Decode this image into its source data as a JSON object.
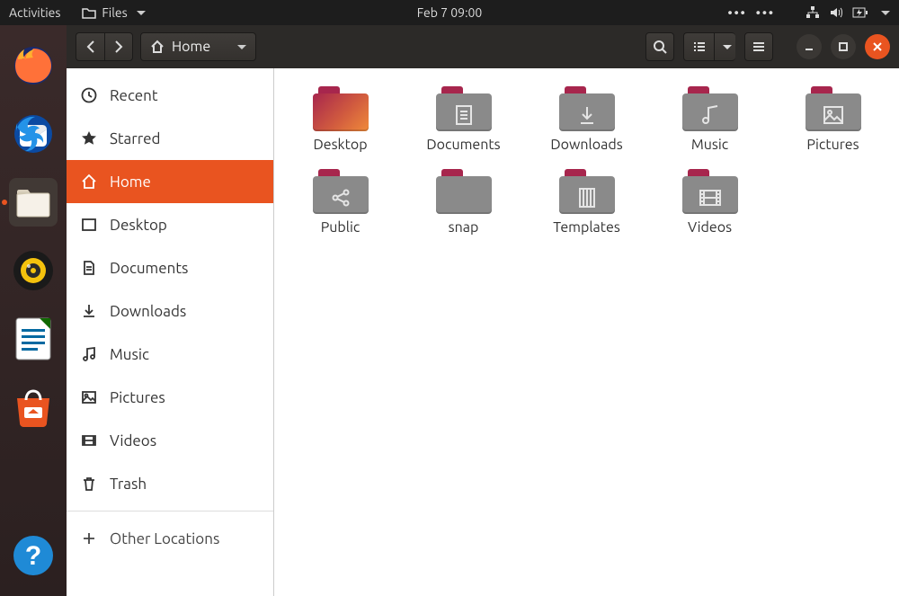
{
  "top_panel": {
    "activities": "Activities",
    "app_menu": "Files",
    "datetime": "Feb 7  09:00"
  },
  "titlebar": {
    "location": "Home"
  },
  "sidebar": {
    "items": [
      {
        "id": "recent",
        "label": "Recent"
      },
      {
        "id": "starred",
        "label": "Starred"
      },
      {
        "id": "home",
        "label": "Home"
      },
      {
        "id": "desktop",
        "label": "Desktop"
      },
      {
        "id": "documents",
        "label": "Documents"
      },
      {
        "id": "downloads",
        "label": "Downloads"
      },
      {
        "id": "music",
        "label": "Music"
      },
      {
        "id": "pictures",
        "label": "Pictures"
      },
      {
        "id": "videos",
        "label": "Videos"
      },
      {
        "id": "trash",
        "label": "Trash"
      }
    ],
    "other_locations": "Other Locations"
  },
  "content": {
    "items": [
      {
        "id": "desktop",
        "label": "Desktop",
        "glyph": "desktop"
      },
      {
        "id": "documents",
        "label": "Documents",
        "glyph": "doc"
      },
      {
        "id": "downloads",
        "label": "Downloads",
        "glyph": "down"
      },
      {
        "id": "music",
        "label": "Music",
        "glyph": "music"
      },
      {
        "id": "pictures",
        "label": "Pictures",
        "glyph": "pic"
      },
      {
        "id": "public",
        "label": "Public",
        "glyph": "share"
      },
      {
        "id": "snap",
        "label": "snap",
        "glyph": ""
      },
      {
        "id": "templates",
        "label": "Templates",
        "glyph": "templ"
      },
      {
        "id": "videos",
        "label": "Videos",
        "glyph": "vid"
      }
    ]
  },
  "colors": {
    "accent": "#e95420",
    "folder_tab": "#a7264d",
    "folder_body": "#8a8a8a"
  }
}
